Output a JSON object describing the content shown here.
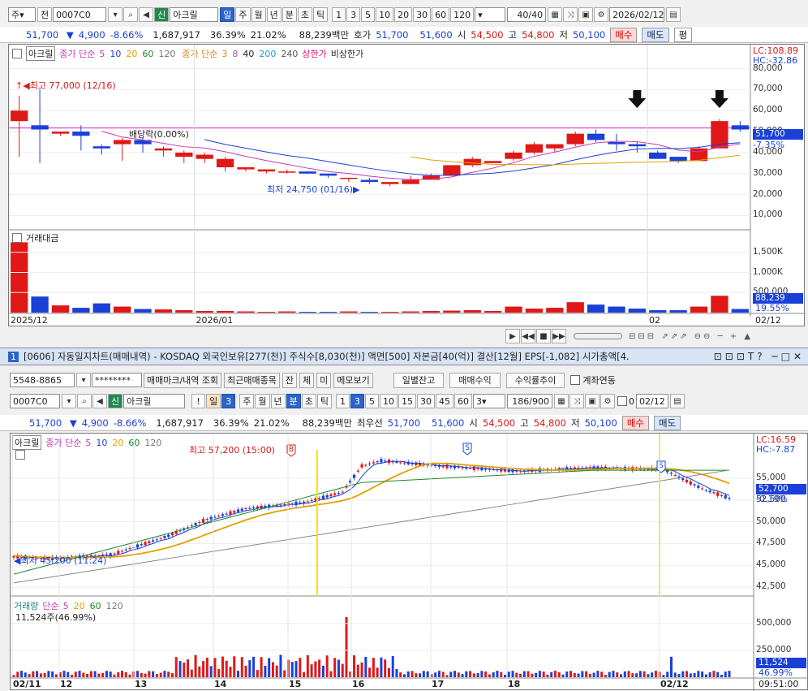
{
  "top": {
    "toolbar": {
      "tab_label": "주",
      "entry_label": "전",
      "code": "0007C0",
      "badge": "신",
      "name": "아크릴",
      "periods": [
        "일",
        "주",
        "월",
        "년",
        "분",
        "초",
        "틱"
      ],
      "period_selected": "일",
      "nums": [
        "1",
        "3",
        "5",
        "10",
        "20",
        "30",
        "60",
        "120"
      ],
      "count": "40",
      "count_max": "/40",
      "date": "2026/02/12"
    },
    "quote": {
      "price": "51,700",
      "change": "4,900",
      "rate": "-8.66%",
      "volume": "1,687,917",
      "turnover": "36.39%",
      "ratio": "21.02%",
      "amount": "88,239백만",
      "hoga_label": "호가",
      "ask": "51,700",
      "bid": "51,600",
      "open_label": "시",
      "open": "54,500",
      "high_label": "고",
      "high": "54,800",
      "low_label": "저",
      "low": "50,100",
      "buy": "매수",
      "sell": "매도",
      "flat": "평"
    },
    "legend": {
      "name": "아크릴",
      "ma1": "종가 단순",
      "ma1_periods": [
        "5",
        "10",
        "20",
        "60",
        "120"
      ],
      "ma2": "종가 단순",
      "ma2_periods": [
        "3",
        "8",
        "40",
        "200",
        "240"
      ],
      "upper": "상한가",
      "lower": "비상한가"
    },
    "price_axis": [
      "80,000",
      "70,000",
      "60,000",
      "50,000",
      "40,000",
      "30,000",
      "20,000",
      "10,000"
    ],
    "lc": "LC:108.89",
    "hc": "HC:-32.86",
    "cur_price": "51,700",
    "cur_rate": "-7.35%",
    "high_label": "최고 77,000 (12/16)",
    "low_label": "최저 24,750 (01/16)",
    "div_label": "배당락(0.00%)",
    "vol_legend": "거래대금",
    "vol_axis": [
      "1,500K",
      "1,000K",
      "500,000"
    ],
    "vol_cur": "88,239",
    "vol_rate": "19.55%",
    "x_labels": [
      "2025/12",
      "2026/01",
      "02",
      "02/12"
    ],
    "candles": [
      [
        55,
        60,
        38,
        67
      ],
      [
        53,
        51,
        35,
        70
      ],
      [
        49,
        50,
        48,
        50
      ],
      [
        50,
        48,
        41,
        53
      ],
      [
        43,
        42,
        39,
        44
      ],
      [
        44,
        46,
        36,
        47
      ],
      [
        46,
        44,
        40,
        47
      ],
      [
        41,
        42,
        38,
        43
      ],
      [
        38,
        40,
        35,
        41
      ],
      [
        37,
        39,
        35,
        40
      ],
      [
        33,
        37,
        31,
        38
      ],
      [
        32,
        33,
        31,
        33
      ],
      [
        31,
        32,
        30,
        32
      ],
      [
        31,
        31,
        30,
        32
      ],
      [
        31,
        30,
        30,
        31
      ],
      [
        30,
        29,
        28,
        30
      ],
      [
        28,
        28,
        26,
        28
      ],
      [
        27,
        26,
        25,
        28
      ],
      [
        25,
        26,
        24,
        26
      ],
      [
        25,
        27,
        25,
        29
      ],
      [
        27,
        29,
        27,
        30
      ],
      [
        29,
        34,
        29,
        34
      ],
      [
        34,
        37,
        33,
        38
      ],
      [
        35,
        36,
        35,
        36
      ],
      [
        37,
        40,
        36,
        41
      ],
      [
        40,
        44,
        39,
        45
      ],
      [
        42,
        44,
        40,
        43
      ],
      [
        44,
        49,
        43,
        50
      ],
      [
        49,
        46,
        45,
        51
      ],
      [
        45,
        44,
        41,
        49
      ],
      [
        44,
        43,
        40,
        45
      ],
      [
        40,
        37,
        37,
        41
      ],
      [
        38,
        36,
        35,
        38
      ],
      [
        36,
        42,
        36,
        43
      ],
      [
        42,
        55,
        42,
        56
      ],
      [
        53,
        51,
        50,
        55
      ]
    ],
    "vol": [
      1750,
      400,
      180,
      120,
      230,
      150,
      90,
      80,
      60,
      40,
      40,
      30,
      20,
      30,
      20,
      20,
      30,
      20,
      20,
      30,
      40,
      50,
      60,
      40,
      150,
      100,
      120,
      260,
      200,
      150,
      100,
      60,
      60,
      150,
      420,
      90
    ]
  },
  "bottom": {
    "title_num": "1",
    "title": "[0606] 자동일지차트(매매내역) - KOSDAQ 외국인보유[277(천)] 주식수[8,030(천)] 액면[500] 자본금[40(억)] 결산[12월] EPS[-1,082] 시가총액[4.",
    "row1": {
      "account": "5548-8865",
      "password": "********",
      "buttons": [
        "매매마크/내역 조회",
        "최근매매종목",
        "잔",
        "체",
        "미",
        "메모보기"
      ],
      "right_buttons": [
        "일별잔고",
        "매매수익",
        "수익률추이"
      ],
      "linked": "계좌연동"
    },
    "row2": {
      "code": "0007C0",
      "badge": "신",
      "name": "아크릴",
      "bang": "!",
      "day": "일",
      "day_num": "3",
      "periods": [
        "주",
        "월",
        "년",
        "분",
        "초",
        "틱"
      ],
      "nums": [
        "1",
        "3",
        "5",
        "10",
        "15",
        "30",
        "45",
        "60"
      ],
      "tick": "3",
      "count": "186",
      "count_max": "/900",
      "zero": "0",
      "date": "02/12"
    },
    "quote": {
      "price": "51,700",
      "change": "4,900",
      "rate": "-8.66%",
      "volume": "1,687,917",
      "turnover": "36.39%",
      "ratio": "21.02%",
      "amount": "88,239백만",
      "bid_label": "최우선",
      "ask": "51,700",
      "bid": "51,600",
      "open_label": "시",
      "open": "54,500",
      "high_label": "고",
      "high": "54,800",
      "low_label": "저",
      "low": "50,100",
      "buy": "매수",
      "sell": "매도"
    },
    "legend": {
      "name": "아크릴",
      "ma": "종가 단순",
      "periods": [
        "5",
        "10",
        "20",
        "60",
        "120"
      ]
    },
    "price_axis": [
      "55,000",
      "52,500",
      "50,000",
      "47,500",
      "45,000",
      "42,500"
    ],
    "lc": "LC:16.59",
    "hc": "HC:-7.87",
    "cur_price": "52,700",
    "cur_rate": "-0.19%",
    "high_label": "최고 57,200 (15:00)",
    "low_label": "최저 45,200 (11:24)",
    "vol_legend": {
      "name": "거래량",
      "ma": "단순",
      "periods": [
        "5",
        "20",
        "60",
        "120"
      ]
    },
    "vol_info": "11,524주(46.99%)",
    "vol_axis": [
      "500,000",
      "250,000"
    ],
    "vol_cur": "11,524",
    "vol_rate": "46.99%",
    "x_labels": [
      "02/11",
      "12",
      "13",
      "14",
      "15",
      "16",
      "17",
      "18",
      "02/12"
    ],
    "time": "09:51:00"
  }
}
